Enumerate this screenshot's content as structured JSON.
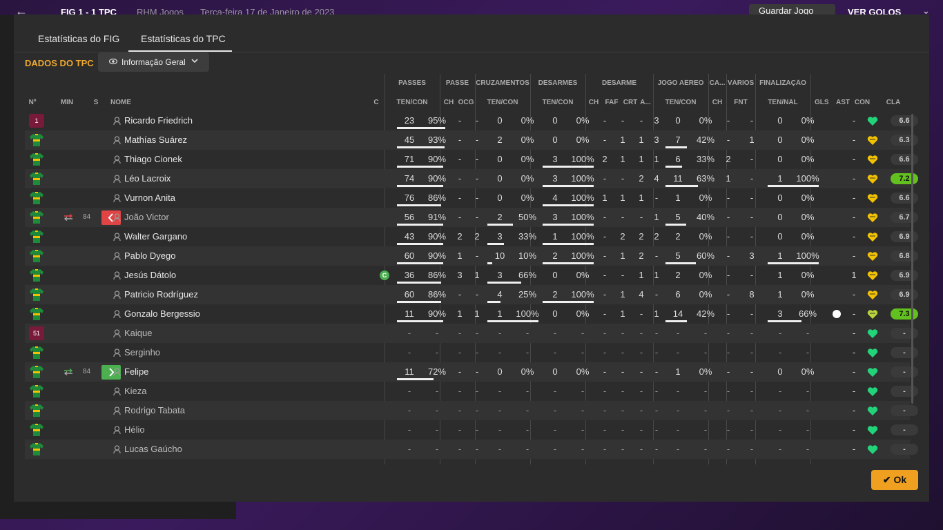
{
  "topbar": {
    "score": "FIG   1 - 1   TPC",
    "subtitle": "RHM Jogos",
    "date": "Terça-feira 17 de Janeiro de 2023",
    "save_label": "Guardar Jogo",
    "goals_label": "VER GOLOS"
  },
  "tabs": [
    {
      "label": "Estatísticas do FIG"
    },
    {
      "label": "Estatísticas do TPC"
    }
  ],
  "section_title": "DADOS DO TPC",
  "dropdown": {
    "label": "Informação Geral"
  },
  "groups": [
    "PASSES",
    "PASSE",
    "CRUZAMENTOS",
    "DESARMES",
    "DESARME",
    "JOGO AÉREO",
    "CA...",
    "VÁRIOS",
    "FINALIZAÇÃO"
  ],
  "subheaders": [
    "Nº",
    "MIN",
    "S",
    "NOME",
    "C",
    "TEN/CON",
    "CH",
    "OCG",
    "TEN/CON",
    "TEN/CON",
    "CH",
    "FAF",
    "CRT",
    "A...",
    "TEN/CON",
    "CH",
    "FNT",
    "TEN/NAL",
    "GLS",
    "AST",
    "CON",
    "CLA"
  ],
  "colors": {
    "accent": "#f0a830",
    "shirt_green": "#1f8a3a",
    "shirt_yellow": "#f2c200",
    "keeper": "#7a1a3a",
    "rating_high": "#62c11f",
    "sub_out": "#e04444",
    "sub_in": "#4caf50",
    "heart_green": "#22d37a",
    "heart_yellow": "#f2c200"
  },
  "players": [
    {
      "num": "1",
      "name": "Ricardo Friedrich",
      "keeper": true,
      "passes": [
        "23",
        "95%"
      ],
      "passes_pct": 0.95,
      "ch": "-",
      "ocg": "-",
      "cruz": [
        "0",
        "0%"
      ],
      "cruz_pct": 0,
      "des": [
        "0",
        "0%"
      ],
      "des_pct": 0,
      "d_ch": "-",
      "faf": "-",
      "crt": "-",
      "a": "3",
      "aer": [
        "0",
        "0%"
      ],
      "aer_pct": 0,
      "ca": "-",
      "fnt": "-",
      "fin": [
        "0",
        "0%"
      ],
      "fin_pct": 0,
      "gls": "",
      "ast": "-",
      "con": "green",
      "cla": "6.6",
      "cla_hi": false
    },
    {
      "num": "",
      "name": "Mathías Suárez",
      "passes": [
        "45",
        "93%"
      ],
      "passes_pct": 0.93,
      "ch": "-",
      "ocg": "-",
      "cruz": [
        "2",
        "0%"
      ],
      "cruz_pct": 0,
      "des": [
        "0",
        "0%"
      ],
      "des_pct": 0,
      "d_ch": "-",
      "faf": "1",
      "crt": "1",
      "a": "3",
      "aer": [
        "7",
        "42%"
      ],
      "aer_pct": 0.42,
      "ca": "-",
      "fnt": "1",
      "fin": [
        "0",
        "0%"
      ],
      "fin_pct": 0,
      "gls": "",
      "ast": "-",
      "con": "yellow",
      "cla": "6.3",
      "cla_hi": false
    },
    {
      "num": "",
      "name": "Thiago Cionek",
      "passes": [
        "71",
        "90%"
      ],
      "passes_pct": 0.9,
      "ch": "-",
      "ocg": "-",
      "cruz": [
        "0",
        "0%"
      ],
      "cruz_pct": 0,
      "des": [
        "3",
        "100%"
      ],
      "des_pct": 1,
      "d_ch": "2",
      "faf": "1",
      "crt": "1",
      "a": "1",
      "aer": [
        "6",
        "33%"
      ],
      "aer_pct": 0.33,
      "ca": "2",
      "fnt": "-",
      "fin": [
        "0",
        "0%"
      ],
      "fin_pct": 0,
      "gls": "",
      "ast": "-",
      "con": "yellow",
      "cla": "6.6",
      "cla_hi": false
    },
    {
      "num": "",
      "name": "Léo Lacroix",
      "passes": [
        "74",
        "90%"
      ],
      "passes_pct": 0.9,
      "ch": "-",
      "ocg": "-",
      "cruz": [
        "0",
        "0%"
      ],
      "cruz_pct": 0,
      "des": [
        "3",
        "100%"
      ],
      "des_pct": 1,
      "d_ch": "-",
      "faf": "-",
      "crt": "2",
      "a": "4",
      "aer": [
        "11",
        "63%"
      ],
      "aer_pct": 0.63,
      "ca": "1",
      "fnt": "-",
      "fin": [
        "1",
        "100%"
      ],
      "fin_pct": 1,
      "gls": "",
      "ast": "-",
      "con": "yellow",
      "cla": "7.2",
      "cla_hi": true
    },
    {
      "num": "",
      "name": "Vurnon Anita",
      "passes": [
        "76",
        "86%"
      ],
      "passes_pct": 0.86,
      "ch": "-",
      "ocg": "-",
      "cruz": [
        "0",
        "0%"
      ],
      "cruz_pct": 0,
      "des": [
        "4",
        "100%"
      ],
      "des_pct": 1,
      "d_ch": "1",
      "faf": "1",
      "crt": "1",
      "a": "-",
      "aer": [
        "1",
        "0%"
      ],
      "aer_pct": 0,
      "ca": "-",
      "fnt": "-",
      "fin": [
        "0",
        "0%"
      ],
      "fin_pct": 0,
      "gls": "",
      "ast": "-",
      "con": "yellow",
      "cla": "6.6",
      "cla_hi": false
    },
    {
      "num": "",
      "name": "João Victor",
      "off": true,
      "sub": "out",
      "min": "84",
      "passes": [
        "56",
        "91%"
      ],
      "passes_pct": 0.91,
      "ch": "-",
      "ocg": "-",
      "cruz": [
        "2",
        "50%"
      ],
      "cruz_pct": 0.5,
      "des": [
        "3",
        "100%"
      ],
      "des_pct": 1,
      "d_ch": "-",
      "faf": "-",
      "crt": "-",
      "a": "1",
      "aer": [
        "5",
        "40%"
      ],
      "aer_pct": 0.4,
      "ca": "-",
      "fnt": "-",
      "fin": [
        "0",
        "0%"
      ],
      "fin_pct": 0,
      "gls": "",
      "ast": "-",
      "con": "yellow",
      "cla": "6.7",
      "cla_hi": false
    },
    {
      "num": "",
      "name": "Walter Gargano",
      "passes": [
        "43",
        "90%"
      ],
      "passes_pct": 0.9,
      "ch": "2",
      "ocg": "2",
      "cruz": [
        "3",
        "33%"
      ],
      "cruz_pct": 0.33,
      "des": [
        "1",
        "100%"
      ],
      "des_pct": 1,
      "d_ch": "-",
      "faf": "2",
      "crt": "2",
      "a": "2",
      "aer": [
        "2",
        "0%"
      ],
      "aer_pct": 0,
      "ca": "-",
      "fnt": "-",
      "fin": [
        "0",
        "0%"
      ],
      "fin_pct": 0,
      "gls": "",
      "ast": "-",
      "con": "yellow",
      "cla": "6.9",
      "cla_hi": false
    },
    {
      "num": "",
      "name": "Pablo Dyego",
      "passes": [
        "60",
        "90%"
      ],
      "passes_pct": 0.9,
      "ch": "1",
      "ocg": "-",
      "cruz": [
        "10",
        "10%"
      ],
      "cruz_pct": 0.1,
      "des": [
        "2",
        "100%"
      ],
      "des_pct": 1,
      "d_ch": "-",
      "faf": "1",
      "crt": "2",
      "a": "-",
      "aer": [
        "5",
        "60%"
      ],
      "aer_pct": 0.6,
      "ca": "-",
      "fnt": "3",
      "fin": [
        "1",
        "100%"
      ],
      "fin_pct": 1,
      "gls": "",
      "ast": "-",
      "con": "yellow",
      "cla": "6.8",
      "cla_hi": false
    },
    {
      "num": "",
      "name": "Jesús Dátolo",
      "captain": true,
      "passes": [
        "36",
        "86%"
      ],
      "passes_pct": 0.86,
      "ch": "3",
      "ocg": "1",
      "cruz": [
        "3",
        "66%"
      ],
      "cruz_pct": 0.66,
      "des": [
        "0",
        "0%"
      ],
      "des_pct": 0,
      "d_ch": "-",
      "faf": "-",
      "crt": "1",
      "a": "1",
      "aer": [
        "2",
        "0%"
      ],
      "aer_pct": 0,
      "ca": "-",
      "fnt": "-",
      "fin": [
        "1",
        "0%"
      ],
      "fin_pct": 0,
      "gls": "",
      "ast": "1",
      "con": "yellow",
      "cla": "6.9",
      "cla_hi": false
    },
    {
      "num": "",
      "name": "Patricio Rodríguez",
      "passes": [
        "60",
        "86%"
      ],
      "passes_pct": 0.86,
      "ch": "-",
      "ocg": "-",
      "cruz": [
        "4",
        "25%"
      ],
      "cruz_pct": 0.25,
      "des": [
        "2",
        "100%"
      ],
      "des_pct": 1,
      "d_ch": "-",
      "faf": "1",
      "crt": "4",
      "a": "-",
      "aer": [
        "6",
        "0%"
      ],
      "aer_pct": 0,
      "ca": "-",
      "fnt": "8",
      "fin": [
        "1",
        "0%"
      ],
      "fin_pct": 0,
      "gls": "",
      "ast": "-",
      "con": "yellow",
      "cla": "6.9",
      "cla_hi": false
    },
    {
      "num": "",
      "name": "Gonzalo Bergessio",
      "goal": true,
      "passes": [
        "11",
        "90%"
      ],
      "passes_pct": 0.9,
      "ch": "1",
      "ocg": "1",
      "cruz": [
        "1",
        "100%"
      ],
      "cruz_pct": 1,
      "des": [
        "0",
        "0%"
      ],
      "des_pct": 0,
      "d_ch": "-",
      "faf": "1",
      "crt": "-",
      "a": "1",
      "aer": [
        "14",
        "42%"
      ],
      "aer_pct": 0.42,
      "ca": "-",
      "fnt": "-",
      "fin": [
        "3",
        "66%"
      ],
      "fin_pct": 0.66,
      "gls": "",
      "ast": "-",
      "con": "yellowgreen",
      "cla": "7.3",
      "cla_hi": true
    },
    {
      "num": "51",
      "name": "Kaique",
      "keeper": true,
      "off": true,
      "empty": true,
      "con": "green",
      "cla": "-",
      "ast": "-"
    },
    {
      "num": "",
      "name": "Serginho",
      "off": true,
      "empty": true,
      "con": "green",
      "cla": "-",
      "ast": "-"
    },
    {
      "num": "",
      "name": "Felipe",
      "sub": "in",
      "min": "84",
      "passes": [
        "11",
        "72%"
      ],
      "passes_pct": 0.72,
      "ch": "-",
      "ocg": "-",
      "cruz": [
        "0",
        "0%"
      ],
      "cruz_pct": 0,
      "des": [
        "0",
        "0%"
      ],
      "des_pct": 0,
      "d_ch": "-",
      "faf": "-",
      "crt": "-",
      "a": "-",
      "aer": [
        "1",
        "0%"
      ],
      "aer_pct": 0,
      "ca": "-",
      "fnt": "-",
      "fin": [
        "0",
        "0%"
      ],
      "fin_pct": 0,
      "gls": "",
      "ast": "-",
      "con": "green",
      "cla": "-",
      "cla_hi": false
    },
    {
      "num": "",
      "name": "Kieza",
      "off": true,
      "empty": true,
      "con": "green",
      "cla": "-",
      "ast": "-"
    },
    {
      "num": "",
      "name": "Rodrigo Tabata",
      "off": true,
      "empty": true,
      "con": "green",
      "cla": "-",
      "ast": "-"
    },
    {
      "num": "",
      "name": "Hélio",
      "off": true,
      "empty": true,
      "con": "green",
      "cla": "-",
      "ast": "-"
    },
    {
      "num": "",
      "name": "Lucas Gaúcho",
      "off": true,
      "empty": true,
      "con": "green",
      "cla": "-",
      "ast": "-"
    }
  ],
  "ok_label": "Ok"
}
